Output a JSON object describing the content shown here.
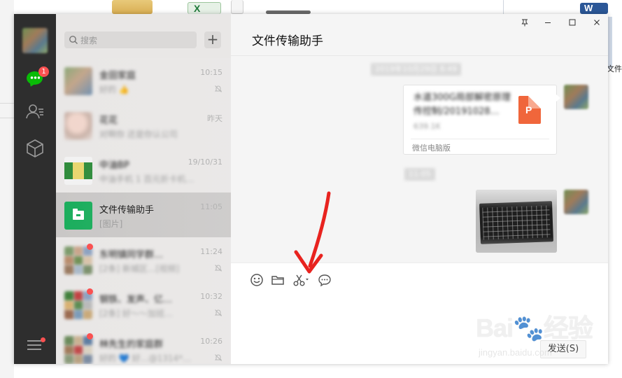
{
  "desktop": {
    "right_label": "文件.",
    "excel_letter": "X",
    "word_letter": "W"
  },
  "nav": {
    "badge_count": "1",
    "badge_color": "#fa5151",
    "accent_color": "#09bb07",
    "icons": [
      "chat-icon",
      "contacts-icon",
      "favorites-box-icon",
      "menu-icon"
    ]
  },
  "search": {
    "placeholder": "搜索",
    "add_label": "+"
  },
  "chats": [
    {
      "name": "金田家庭",
      "preview": "好的  👍",
      "time": "10:15",
      "muted": true,
      "blurred": true
    },
    {
      "name": "花花",
      "preview": "对啊你  还是你认公司",
      "time": "昨天",
      "muted": false,
      "blurred": true
    },
    {
      "name": "中油BP",
      "preview": "中油手机 1 百元折卡机…",
      "time": "19/10/31",
      "muted": false,
      "blurred": true
    },
    {
      "name": "文件传输助手",
      "preview": "[图片]",
      "time": "11:05",
      "muted": false,
      "blurred": false,
      "active": true
    },
    {
      "name": "东明镇同学群…",
      "preview": "[2条] 新城区…[视频]",
      "time": "11:24",
      "muted": true,
      "blurred": true
    },
    {
      "name": "钢铁、发声、亿…",
      "preview": "[2条] 好～～加班…",
      "time": "10:32",
      "muted": true,
      "blurred": true
    },
    {
      "name": "林先生的家庭群",
      "preview": "好的 💙 好…@1314*…",
      "time": "10:26",
      "muted": true,
      "blurred": true
    }
  ],
  "conversation": {
    "title": "文件传输助手",
    "window_controls": [
      "pin-icon",
      "minimize-icon",
      "maximize-icon",
      "close-icon"
    ],
    "timestamp_1": "2019年10月29日 8:49",
    "file_message": {
      "name": "水道300G局部解密原理传控制/20191028…",
      "size": "639.1K",
      "source": "微信电脑版",
      "type_letter": "P",
      "icon_color": "#f0663b"
    },
    "timestamp_2": "11:05",
    "image_message": "keyboard photo"
  },
  "input": {
    "tools": [
      "emoji-icon",
      "folder-icon",
      "screenshot-scissors-icon",
      "chat-history-icon"
    ],
    "send_label": "发送(S)"
  },
  "watermark": {
    "main": "Bai🐾经验",
    "sub": "jingyan.baidu.com"
  }
}
